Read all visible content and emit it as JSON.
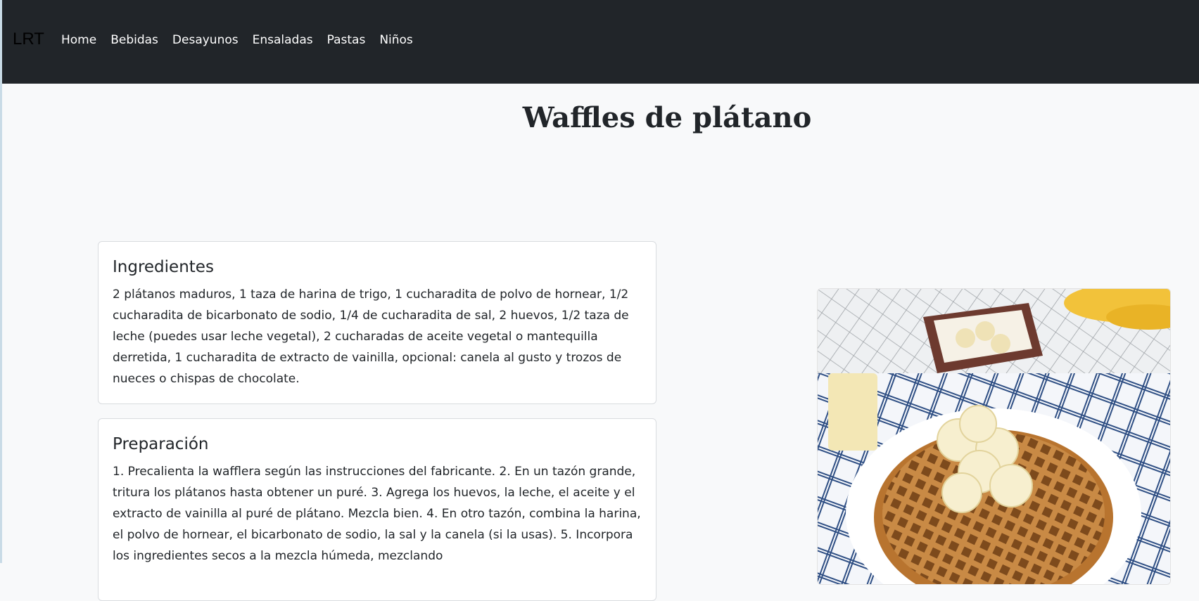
{
  "navbar": {
    "brand": "LRT",
    "links": [
      "Home",
      "Bebidas",
      "Desayunos",
      "Ensaladas",
      "Pastas",
      "Niños"
    ]
  },
  "recipe": {
    "title": "Waffles de plátano",
    "ingredients": {
      "heading": "Ingredientes",
      "text": "2 plátanos maduros, 1 taza de harina de trigo, 1 cucharadita de polvo de hornear, 1/2 cucharadita de bicarbonato de sodio, 1/4 de cucharadita de sal, 2 huevos, 1/2 taza de leche (puedes usar leche vegetal), 2 cucharadas de aceite vegetal o mantequilla derretida, 1 cucharadita de extracto de vainilla, opcional: canela al gusto y trozos de nueces o chispas de chocolate."
    },
    "preparation": {
      "heading": "Preparación",
      "text": "1. Precalienta la wafflera según las instrucciones del fabricante. 2. En un tazón grande, tritura los plátanos hasta obtener un puré. 3. Agrega los huevos, la leche, el aceite y el extracto de vainilla al puré de plátano. Mezcla bien. 4. En otro tazón, combina la harina, el polvo de hornear, el bicarbonato de sodio, la sal y la canela (si la usas). 5. Incorpora los ingredientes secos a la mezcla húmeda, mezclando"
    }
  },
  "colors": {
    "navbar_bg": "#212529",
    "page_bg": "#f8f9fa",
    "text": "#212529"
  }
}
